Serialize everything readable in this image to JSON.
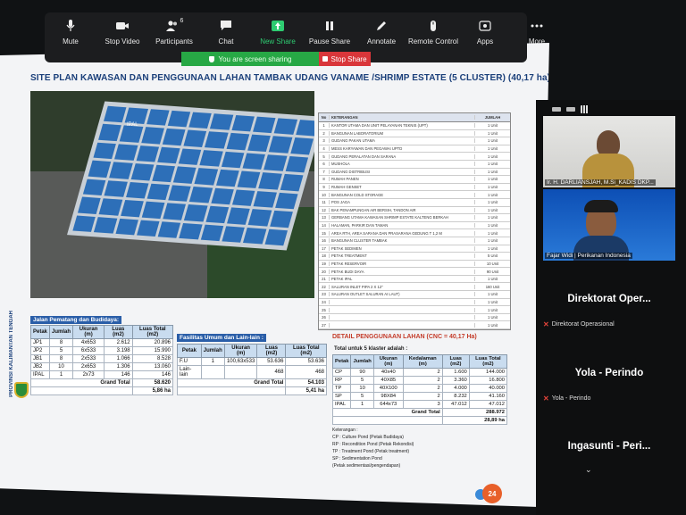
{
  "toolbar": {
    "items": [
      {
        "label": "Mute",
        "icon": "microphone-icon"
      },
      {
        "label": "Stop Video",
        "icon": "video-camera-icon"
      },
      {
        "label": "Participants",
        "icon": "participants-icon",
        "count": "6"
      },
      {
        "label": "Chat",
        "icon": "chat-bubble-icon"
      },
      {
        "label": "New Share",
        "icon": "share-arrow-icon"
      },
      {
        "label": "Pause Share",
        "icon": "pause-icon"
      },
      {
        "label": "Annotate",
        "icon": "pen-icon"
      },
      {
        "label": "Remote Control",
        "icon": "mouse-icon"
      },
      {
        "label": "Apps",
        "icon": "apps-icon"
      },
      {
        "label": "More",
        "icon": "more-dots-icon"
      }
    ],
    "sharing_text": "You are screen sharing",
    "stop_share": "Stop Share",
    "accent_green": "#2ecc71",
    "stop_red": "#d9363a"
  },
  "slide": {
    "title": "SITE PLAN KAWASAN DAN PENGGUNAAN LAHAN TAMBAK UDANG VANAME /SHRIMP ESTATE (5 CLUSTER) (40,17 ha)",
    "province": "PROVINSI KALIMANTAN TENGAH",
    "plan_label": "IPAL",
    "ket_header": {
      "no": "No",
      "desc": "KETERANGAN",
      "qty": "JUMLAH"
    },
    "ket_rows": [
      {
        "no": "1",
        "desc": "KANTOR UTAMA DAN UNIT PELAYANAN TEKNIS (UPT)",
        "qty": "1 Unit"
      },
      {
        "no": "2",
        "desc": "BANGUNAN LABORATORIUM",
        "qty": "1 Unit"
      },
      {
        "no": "3",
        "desc": "GUDANG PAKAN UTAMA",
        "qty": "1 Unit"
      },
      {
        "no": "4",
        "desc": "MESS KARYAWAN DAN PEGAWAI UPTD",
        "qty": "1 Unit"
      },
      {
        "no": "5",
        "desc": "GUDANG PERALATAN DAN SARANA",
        "qty": "1 Unit"
      },
      {
        "no": "6",
        "desc": "MUSHOLA",
        "qty": "1 Unit"
      },
      {
        "no": "7",
        "desc": "GUDANG DISTRIBUSI",
        "qty": "1 Unit"
      },
      {
        "no": "8",
        "desc": "RUMAH PANEN",
        "qty": "1 Unit"
      },
      {
        "no": "9",
        "desc": "RUMAH GENSET",
        "qty": "1 Unit"
      },
      {
        "no": "10",
        "desc": "BANGUNAN COLD STORAGE",
        "qty": "1 Unit"
      },
      {
        "no": "11",
        "desc": "POS JAGA",
        "qty": "1 Unit"
      },
      {
        "no": "12",
        "desc": "BAK PENAMPUNGAN AIR BERSIH, TANDON AIR",
        "qty": "1 Unit"
      },
      {
        "no": "13",
        "desc": "GERBANG UTAMA KAWASAN SHRIMP ESTATE KALTENG BERKAH",
        "qty": "1 Unit"
      },
      {
        "no": "14",
        "desc": "HALAMAN, PARKIR DAN TAMAN",
        "qty": "1 Unit"
      },
      {
        "no": "15",
        "desc": "AREA RTH, AREA SARANA DAN PRASARANA GEDUNG T 1,2 M",
        "qty": "1 Unit"
      },
      {
        "no": "16",
        "desc": "BANGUNAN CLUSTER TAMBAK",
        "qty": "1 Unit"
      },
      {
        "no": "17",
        "desc": "PETAK SEDIMEN",
        "qty": "1 Unit"
      },
      {
        "no": "18",
        "desc": "PETAK TREATMENT",
        "qty": "5 Unit"
      },
      {
        "no": "19",
        "desc": "PETAK RESERVOIR",
        "qty": "10 Unit"
      },
      {
        "no": "20",
        "desc": "PETAK BUDI DAYA",
        "qty": "90 Unit"
      },
      {
        "no": "21",
        "desc": "PETAK IPAL",
        "qty": "1 Unit"
      },
      {
        "no": "22",
        "desc": "SALURAN INLET PIPA 2 X 12\"",
        "qty": "160 Unit"
      },
      {
        "no": "23",
        "desc": "SALURAN OUTLET SALURAN AI LAUT)",
        "qty": "1 Unit"
      },
      {
        "no": "24",
        "desc": "",
        "qty": "1 Unit"
      },
      {
        "no": "25",
        "desc": "",
        "qty": "1 Unit"
      },
      {
        "no": "26",
        "desc": "",
        "qty": "1 Unit"
      },
      {
        "no": "27",
        "desc": "",
        "qty": "1 Unit"
      }
    ],
    "detail_title": "DETAIL PENGGUNAAN LAHAN (CNC = 40,17 Ha)",
    "total_title": "Total untuk 5 klaster adalah :",
    "jalan": {
      "label": "Jalan Pematang dan Budidaya:",
      "headers": [
        "Petak",
        "Jumlah",
        "Ukuran (m)",
        "Luas (m2)",
        "Luas Total (m2)"
      ],
      "rows": [
        [
          "JP1",
          "8",
          "4x653",
          "2.612",
          "20.896"
        ],
        [
          "JP2",
          "5",
          "6x533",
          "3.198",
          "15.990"
        ],
        [
          "JB1",
          "8",
          "2x533",
          "1.066",
          "8.528"
        ],
        [
          "JB2",
          "10",
          "2x653",
          "1.306",
          "13.060"
        ],
        [
          "IPAL",
          "1",
          "2x73",
          "146",
          "146"
        ]
      ],
      "grand_label": "Grand Total",
      "grand_value": "58.620",
      "ha_value": "5,86 ha"
    },
    "fasilitas": {
      "label": "Fasilitas Umum dan Lain-lain :",
      "headers": [
        "Petak",
        "Jumlah",
        "Ukuran (m)",
        "Luas (m2)",
        "Luas Total (m2)"
      ],
      "rows": [
        [
          "F.U",
          "1",
          "100,63x533",
          "53.636",
          "53.636"
        ],
        [
          "Lain-lain",
          "",
          "",
          "468",
          "468"
        ]
      ],
      "grand_label": "Grand Total",
      "grand_value": "54.103",
      "ha_value": "5,41 ha"
    },
    "klaster": {
      "headers": [
        "Petak",
        "Jumlah",
        "Ukuran (m)",
        "Kedalaman (m)",
        "Luas (m2)",
        "Luas Total (m2)"
      ],
      "rows": [
        [
          "CP",
          "90",
          "40x40",
          "2",
          "1.600",
          "144.000"
        ],
        [
          "RP",
          "5",
          "40X85",
          "2",
          "3.360",
          "16.800"
        ],
        [
          "TP",
          "10",
          "40X100",
          "2",
          "4.000",
          "40.000"
        ],
        [
          "SP",
          "5",
          "98X84",
          "2",
          "8.232",
          "41.160"
        ],
        [
          "IPAL",
          "1",
          "644x73",
          "3",
          "47.012",
          "47.012"
        ]
      ],
      "grand_label": "Grand Total",
      "grand_value": "288.972",
      "ha_value": "28,89 ha"
    },
    "legend_title": "Keterangan :",
    "legend": [
      "CP : Culture Pond (Petak Budidaya)",
      "RP : Recondition Pond (Petak Rekondisi)",
      "TP : Treatment Pond (Petak treatment)",
      "SP : Sedimentation Pond",
      "     (Petak sedimentasi/pengendapan)"
    ],
    "page_number": "24"
  },
  "participants": [
    {
      "name": "Ir. H. DARLIANSJAH, M.Si_KADIS DKP...",
      "type": "video"
    },
    {
      "name": "Fajar Widi | Perikanan Indonesia",
      "type": "video"
    },
    {
      "name": "Direktorat Oper...",
      "sub": "Direktorat Operasional",
      "type": "avatar"
    },
    {
      "name": "Yola - Perindo",
      "sub": "Yola - Perindo",
      "type": "avatar"
    },
    {
      "name": "Ingasunti - Peri...",
      "type": "avatar"
    }
  ]
}
